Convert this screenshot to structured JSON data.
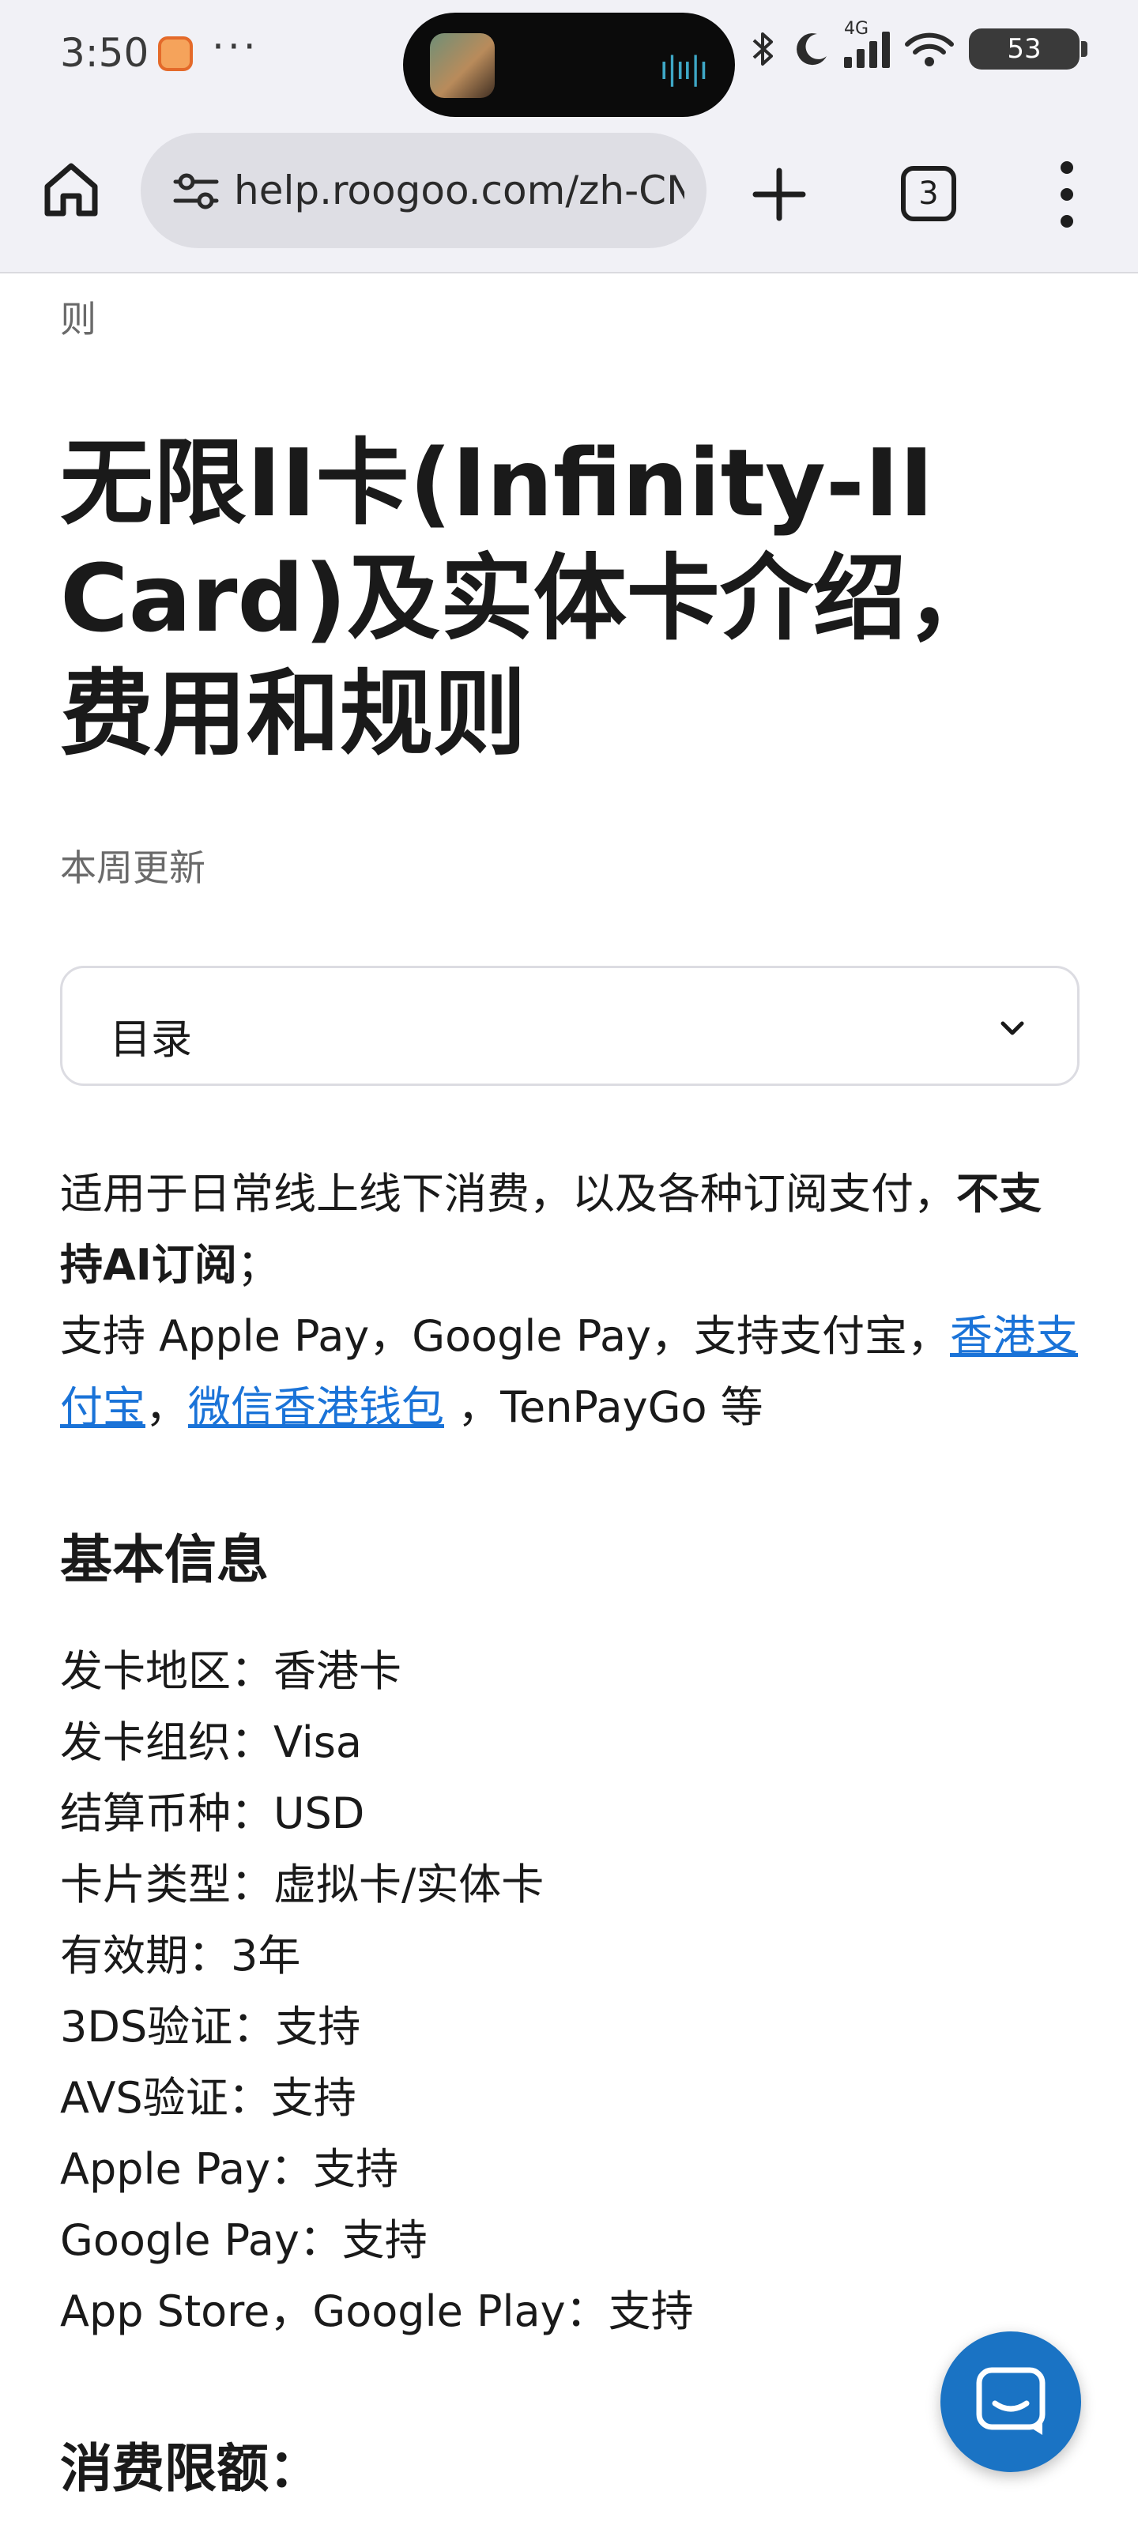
{
  "status_bar": {
    "time": "3:50",
    "dots": "···",
    "network_label": "4G",
    "battery": "53"
  },
  "browser": {
    "url": "help.roogoo.com/zh-CN",
    "tab_count": "3"
  },
  "page": {
    "crumb_tail": "则",
    "title": "无限ⅠⅠ卡(Infinity-ⅠⅠ Card)及实体卡介绍，费用和规则",
    "updated": "本周更新",
    "toc_label": "目录",
    "intro": {
      "line1_plain": "适用于日常线上线下消费，以及各种订阅支付，",
      "line1_bold": "不支持AI订阅",
      "line1_end": "；",
      "line2_plain": "支持 Apple Pay，Google Pay，支持支付宝，",
      "link1": "香港支付宝",
      "sep": "，",
      "link2": "微信香港钱包",
      "line2_end": " ，TenPayGo 等"
    },
    "basic_heading": "基本信息",
    "basic_info": [
      "发卡地区：香港卡",
      "发卡组织：Visa",
      "结算币种：USD",
      "卡片类型：虚拟卡/实体卡",
      "有效期：3年",
      "3DS验证：支持",
      "AVS验证：支持",
      "Apple Pay：支持",
      "Google Pay：支持",
      "App Store，Google Play：支持"
    ],
    "limit_heading": "消费限额："
  },
  "colors": {
    "link": "#1a73d8",
    "fab": "#1a73c4",
    "chrome_bg": "#f1f1f6"
  }
}
